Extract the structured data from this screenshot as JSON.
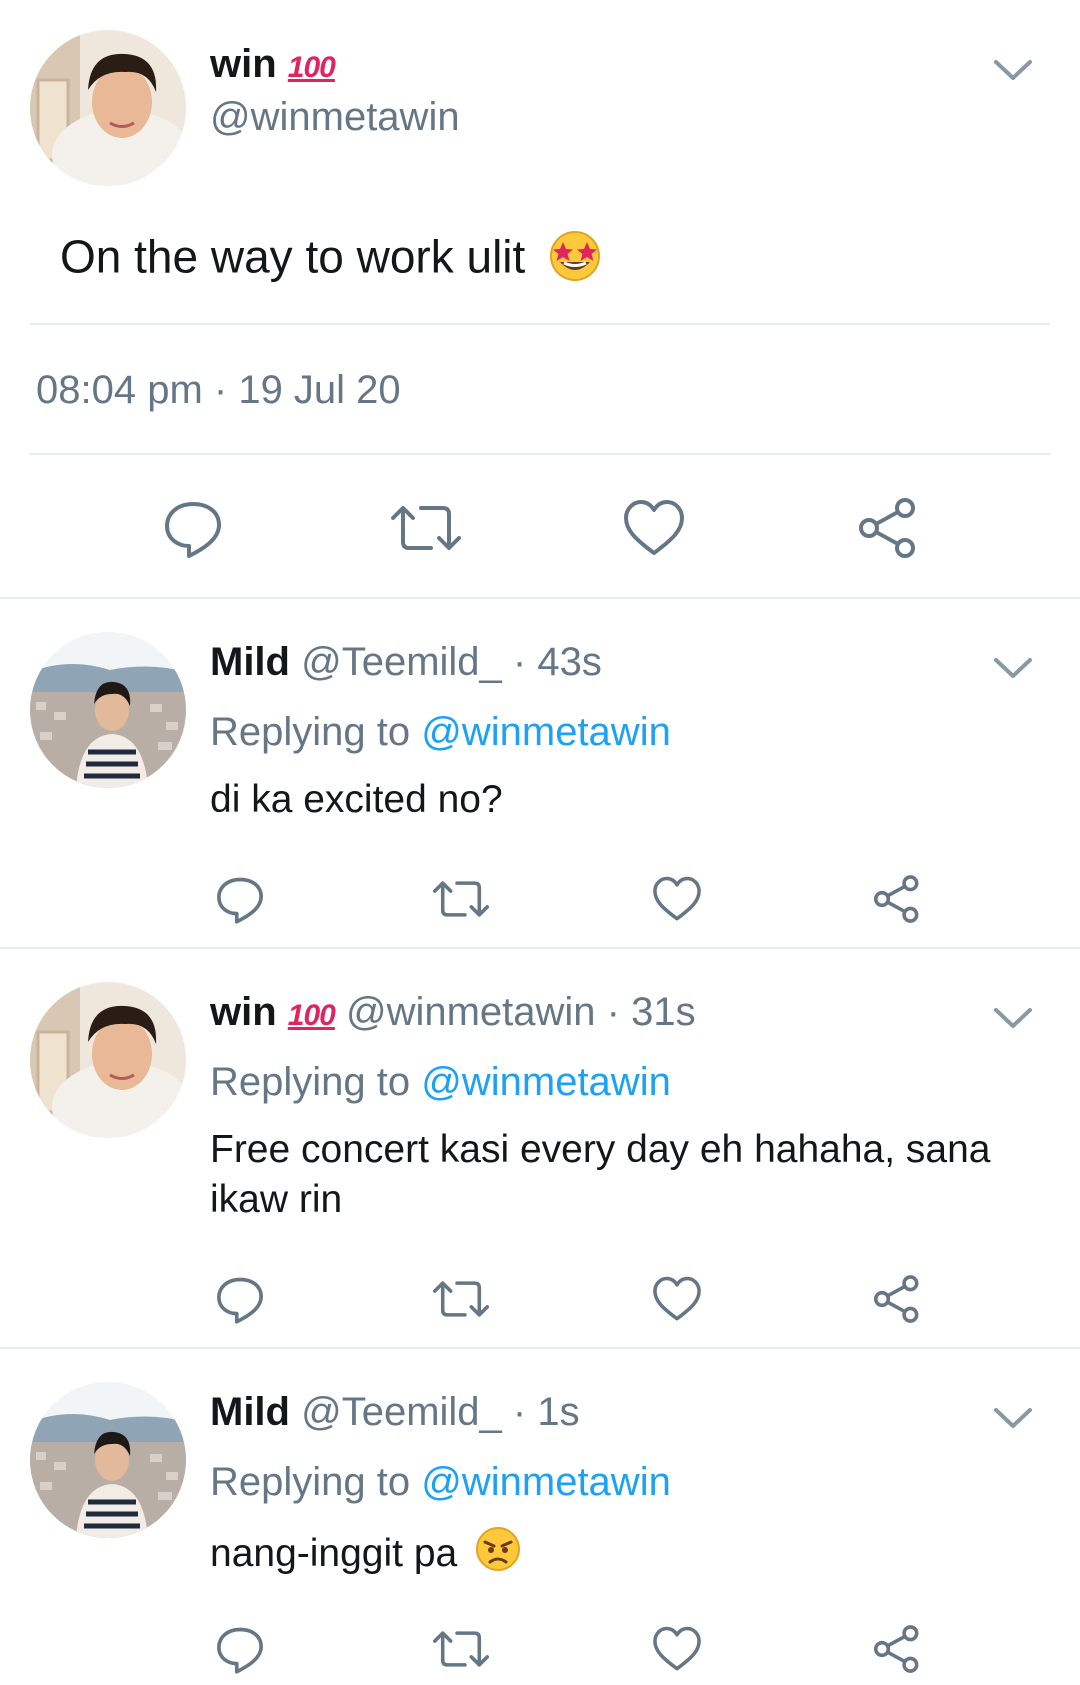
{
  "main_tweet": {
    "name": "win",
    "badge": "100",
    "handle": "@winmetawin",
    "text": "On the way to work ulit",
    "timestamp": "08:04 pm · 19 Jul 20"
  },
  "replies": [
    {
      "name": "Mild",
      "handle": "@Teemild_",
      "time": " · 43s",
      "replying_label": "Replying to",
      "replying_to": "@winmetawin",
      "text": "di ka excited no?"
    },
    {
      "name": "win",
      "badge": "100",
      "handle": "@winmetawin",
      "time": " · 31s",
      "replying_label": "Replying to",
      "replying_to": "@winmetawin",
      "text": "Free concert kasi every day eh hahaha, sana ikaw rin"
    },
    {
      "name": "Mild",
      "handle": "@Teemild_",
      "time": " · 1s",
      "replying_label": "Replying to",
      "replying_to": "@winmetawin",
      "text": "nang-inggit pa"
    }
  ],
  "colors": {
    "link": "#1da1f2",
    "secondary_text": "#657786",
    "icon": "#657786",
    "divider": "#e6ecf0"
  }
}
